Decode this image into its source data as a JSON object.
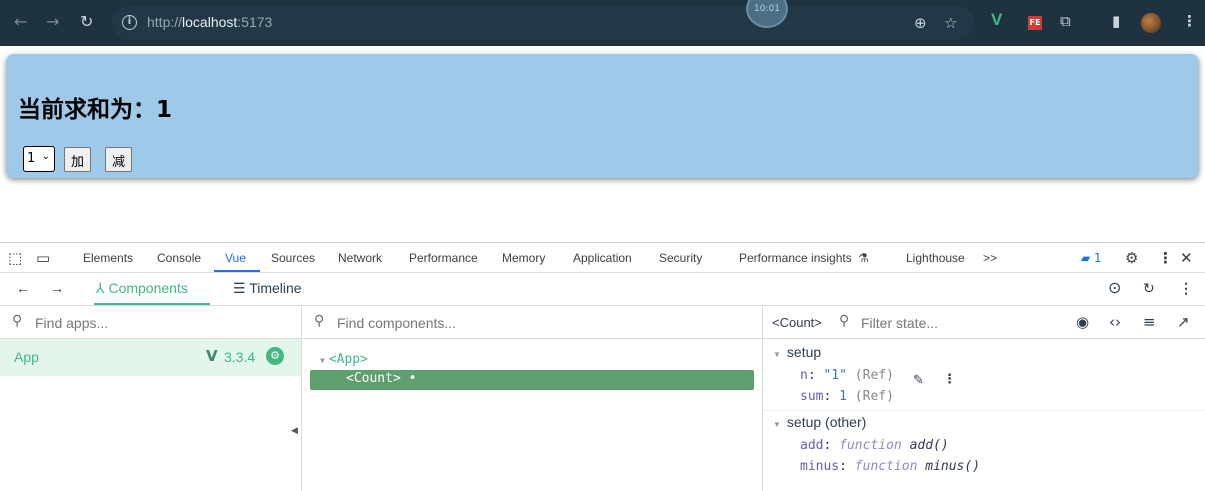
{
  "browser": {
    "url_prefix": "http://",
    "url_host": "localhost",
    "url_port": ":5173",
    "recording_badge": "10:01",
    "extensions": [
      "V",
      "FE"
    ],
    "icons": [
      "back-icon",
      "forward-icon",
      "reload-icon",
      "zoom-icon",
      "star-icon",
      "puzzle-icon",
      "sidepanel-icon",
      "menu-icon"
    ]
  },
  "app": {
    "heading": "当前求和为：1",
    "select_value": "1",
    "add_label": "加",
    "minus_label": "减",
    "box_color": "#9ec9e8"
  },
  "devtools": {
    "tabs": [
      "Elements",
      "Console",
      "Vue",
      "Sources",
      "Network",
      "Performance",
      "Memory",
      "Application",
      "Security",
      "Performance insights",
      "Lighthouse"
    ],
    "active_tab": "Vue",
    "more_tabs": ">>",
    "issues_count": "1",
    "accent": "#1a73e8"
  },
  "vue": {
    "components_label": "Components",
    "timeline_label": "Timeline",
    "find_apps_placeholder": "Find apps...",
    "find_components_placeholder": "Find components...",
    "filter_state_placeholder": "Filter state...",
    "app_name": "App",
    "vue_version": "3.3.4",
    "tree_root": "<App>",
    "tree_selected": "<Count> •",
    "selected_component": "<Count>",
    "sections": {
      "setup": "setup",
      "setup_other": "setup (other)"
    },
    "state": {
      "n_key": "n",
      "n_value": "\"1\"",
      "n_type": "(Ref)",
      "sum_key": "sum",
      "sum_value": "1",
      "sum_type": "(Ref)",
      "add_key": "add",
      "add_kw": "function",
      "add_fn": "add()",
      "minus_key": "minus",
      "minus_kw": "function",
      "minus_fn": "minus()"
    },
    "accent": "#42b883"
  }
}
